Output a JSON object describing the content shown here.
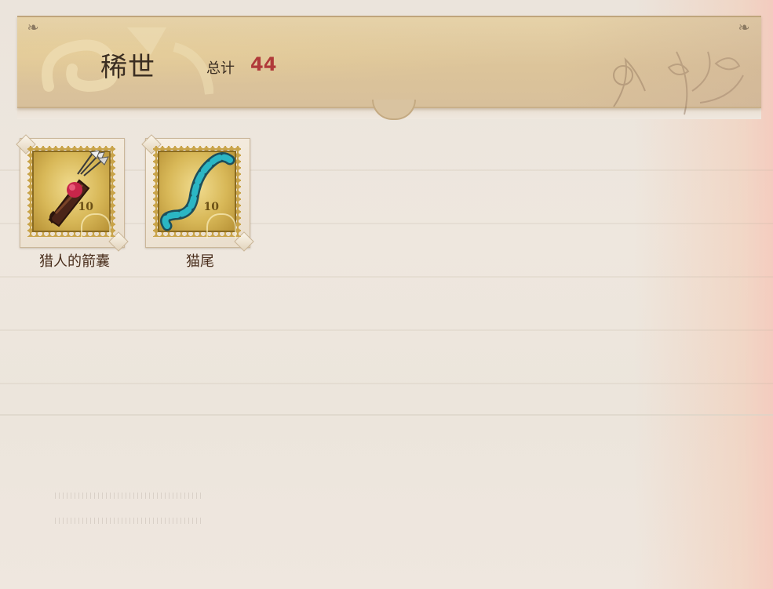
{
  "header": {
    "title": "稀世",
    "total_label": "总计",
    "total_value": "44"
  },
  "items": [
    {
      "name": "猎人的箭囊",
      "stamp_value": "10",
      "icon": "quiver-icon"
    },
    {
      "name": "猫尾",
      "stamp_value": "10",
      "icon": "cat-tail-icon"
    }
  ],
  "colors": {
    "accent_red": "#b03a3a",
    "text_brown": "#3b2e22",
    "stamp_gold": "#c9a44a",
    "tail_cyan": "#2bb6c4"
  }
}
